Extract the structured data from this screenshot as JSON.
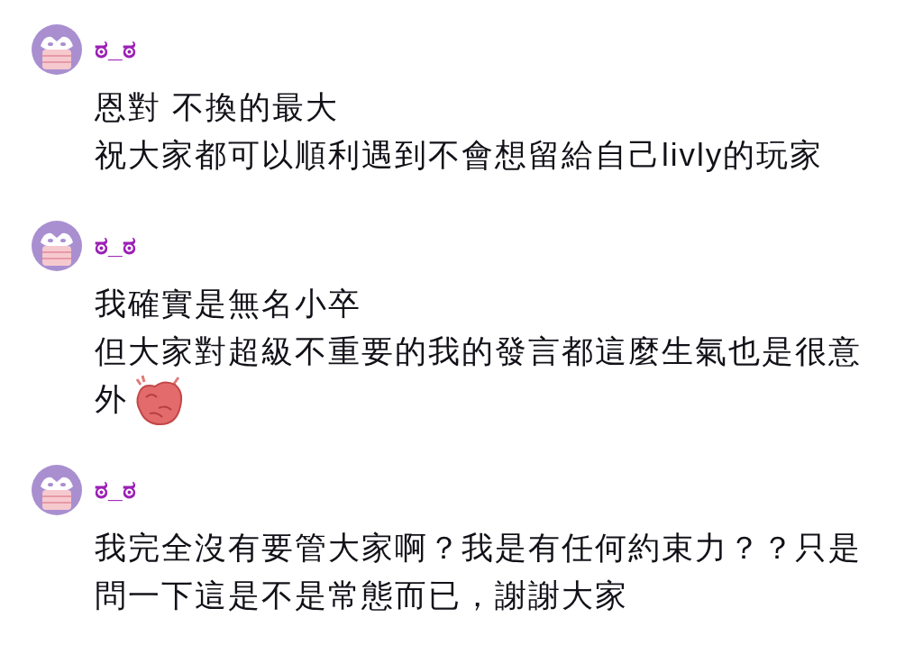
{
  "comments": [
    {
      "username": "ಠ_ಠ",
      "lines": [
        {
          "text": "恩對 不換的最大",
          "sticker": false
        },
        {
          "text": "祝大家都可以順利遇到不會想留給自己livly的玩家",
          "sticker": false
        }
      ]
    },
    {
      "username": "ಠ_ಠ",
      "lines": [
        {
          "text": "我確實是無名小卒",
          "sticker": false
        },
        {
          "text": "但大家對超級不重要的我的發言都這麼生氣也是很意",
          "sticker": false
        },
        {
          "text": "外",
          "sticker": true
        }
      ]
    },
    {
      "username": "ಠ_ಠ",
      "lines": [
        {
          "text": "我完全沒有要管大家啊？我是有任何約束力？？只是",
          "sticker": false
        },
        {
          "text": "問一下這是不是常態而已，謝謝大家",
          "sticker": false
        }
      ]
    }
  ]
}
